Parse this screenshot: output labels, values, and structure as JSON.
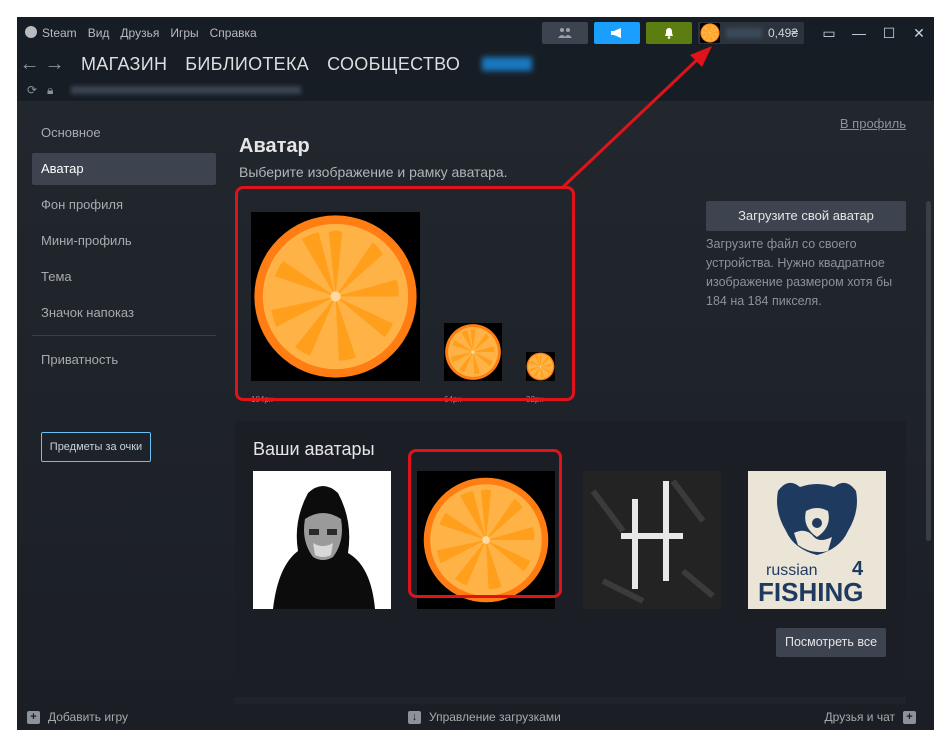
{
  "menu": [
    "Steam",
    "Вид",
    "Друзья",
    "Игры",
    "Справка"
  ],
  "account": {
    "balance": "0,49₴"
  },
  "nav_tabs": [
    "МАГАЗИН",
    "БИБЛИОТЕКА",
    "СООБЩЕСТВО"
  ],
  "sidebar": {
    "items": [
      "Основное",
      "Аватар",
      "Фон профиля",
      "Мини-профиль",
      "Тема",
      "Значок напоказ"
    ],
    "privacy": "Приватность",
    "points_button": "Предметы за очки"
  },
  "main": {
    "profile_link": "В профиль",
    "title": "Аватар",
    "subtitle": "Выберите изображение и рамку аватара.",
    "preview_sizes": [
      "184px",
      "64px",
      "32px"
    ],
    "upload_button": "Загрузите свой аватар",
    "upload_description": "Загрузите файл со своего устройства. Нужно квадратное изображение размером хотя бы 184 на 184 пикселя.",
    "your_avatars_title": "Ваши аватары",
    "avatars": [
      "hooded-figure",
      "orange-slice",
      "dark-crosses",
      "russian-fishing-4"
    ],
    "russian_fishing_text": [
      "russian",
      "FISHING",
      "4"
    ],
    "view_all_button": "Посмотреть все"
  },
  "statusbar": {
    "add_game": "Добавить игру",
    "downloads": "Управление загрузками",
    "friends_chat": "Друзья и чат"
  },
  "colors": {
    "accent_blue": "#1a9fff",
    "highlight_red": "#e0131a",
    "orange": "#ff8c1a"
  }
}
